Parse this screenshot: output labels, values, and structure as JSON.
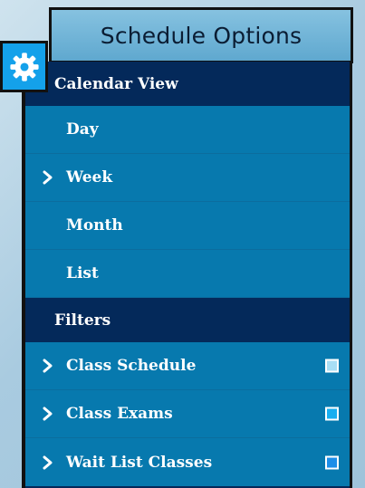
{
  "header": {
    "title": "Schedule Options",
    "icon": "gear-icon"
  },
  "calendar_view": {
    "heading": "Calendar View",
    "items": [
      {
        "label": "Day",
        "chevron": false
      },
      {
        "label": "Week",
        "chevron": true
      },
      {
        "label": "Month",
        "chevron": false
      },
      {
        "label": "List",
        "chevron": false
      }
    ]
  },
  "filters": {
    "heading": "Filters",
    "items": [
      {
        "label": "Class Schedule",
        "chevron": true,
        "color": "#a8def5"
      },
      {
        "label": "Class Exams",
        "chevron": true,
        "color": "#18aef0"
      },
      {
        "label": "Wait List Classes",
        "chevron": true,
        "color": "#1c8ee8"
      }
    ]
  },
  "colors": {
    "panel_dark": "#04295a",
    "item_blue": "#0779ae",
    "header_blue": "#6fb4d8",
    "gear_blue": "#14a1ea"
  }
}
